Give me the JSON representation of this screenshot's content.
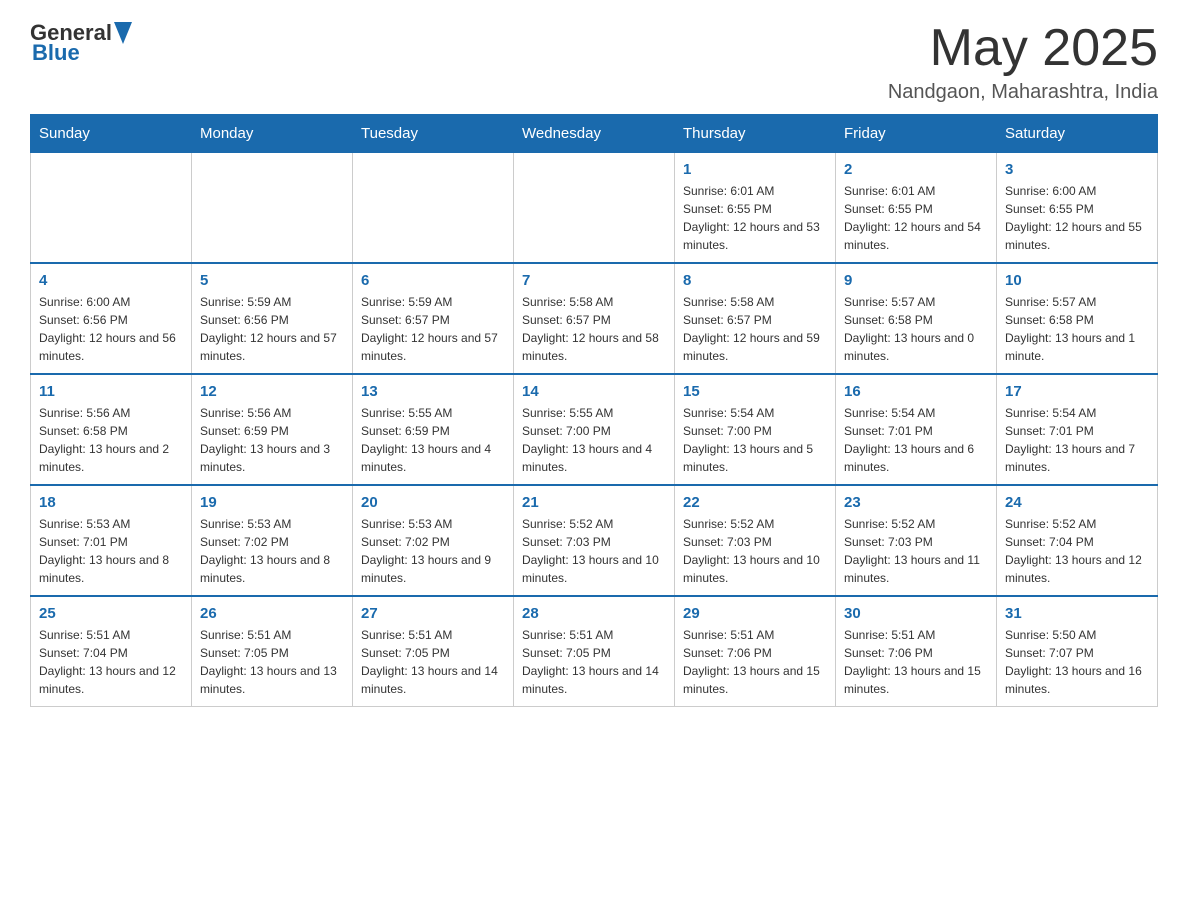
{
  "header": {
    "logo": {
      "general": "General",
      "blue": "Blue"
    },
    "title": "May 2025",
    "location": "Nandgaon, Maharashtra, India"
  },
  "weekdays": [
    "Sunday",
    "Monday",
    "Tuesday",
    "Wednesday",
    "Thursday",
    "Friday",
    "Saturday"
  ],
  "weeks": [
    [
      {
        "day": "",
        "info": ""
      },
      {
        "day": "",
        "info": ""
      },
      {
        "day": "",
        "info": ""
      },
      {
        "day": "",
        "info": ""
      },
      {
        "day": "1",
        "info": "Sunrise: 6:01 AM\nSunset: 6:55 PM\nDaylight: 12 hours and 53 minutes."
      },
      {
        "day": "2",
        "info": "Sunrise: 6:01 AM\nSunset: 6:55 PM\nDaylight: 12 hours and 54 minutes."
      },
      {
        "day": "3",
        "info": "Sunrise: 6:00 AM\nSunset: 6:55 PM\nDaylight: 12 hours and 55 minutes."
      }
    ],
    [
      {
        "day": "4",
        "info": "Sunrise: 6:00 AM\nSunset: 6:56 PM\nDaylight: 12 hours and 56 minutes."
      },
      {
        "day": "5",
        "info": "Sunrise: 5:59 AM\nSunset: 6:56 PM\nDaylight: 12 hours and 57 minutes."
      },
      {
        "day": "6",
        "info": "Sunrise: 5:59 AM\nSunset: 6:57 PM\nDaylight: 12 hours and 57 minutes."
      },
      {
        "day": "7",
        "info": "Sunrise: 5:58 AM\nSunset: 6:57 PM\nDaylight: 12 hours and 58 minutes."
      },
      {
        "day": "8",
        "info": "Sunrise: 5:58 AM\nSunset: 6:57 PM\nDaylight: 12 hours and 59 minutes."
      },
      {
        "day": "9",
        "info": "Sunrise: 5:57 AM\nSunset: 6:58 PM\nDaylight: 13 hours and 0 minutes."
      },
      {
        "day": "10",
        "info": "Sunrise: 5:57 AM\nSunset: 6:58 PM\nDaylight: 13 hours and 1 minute."
      }
    ],
    [
      {
        "day": "11",
        "info": "Sunrise: 5:56 AM\nSunset: 6:58 PM\nDaylight: 13 hours and 2 minutes."
      },
      {
        "day": "12",
        "info": "Sunrise: 5:56 AM\nSunset: 6:59 PM\nDaylight: 13 hours and 3 minutes."
      },
      {
        "day": "13",
        "info": "Sunrise: 5:55 AM\nSunset: 6:59 PM\nDaylight: 13 hours and 4 minutes."
      },
      {
        "day": "14",
        "info": "Sunrise: 5:55 AM\nSunset: 7:00 PM\nDaylight: 13 hours and 4 minutes."
      },
      {
        "day": "15",
        "info": "Sunrise: 5:54 AM\nSunset: 7:00 PM\nDaylight: 13 hours and 5 minutes."
      },
      {
        "day": "16",
        "info": "Sunrise: 5:54 AM\nSunset: 7:01 PM\nDaylight: 13 hours and 6 minutes."
      },
      {
        "day": "17",
        "info": "Sunrise: 5:54 AM\nSunset: 7:01 PM\nDaylight: 13 hours and 7 minutes."
      }
    ],
    [
      {
        "day": "18",
        "info": "Sunrise: 5:53 AM\nSunset: 7:01 PM\nDaylight: 13 hours and 8 minutes."
      },
      {
        "day": "19",
        "info": "Sunrise: 5:53 AM\nSunset: 7:02 PM\nDaylight: 13 hours and 8 minutes."
      },
      {
        "day": "20",
        "info": "Sunrise: 5:53 AM\nSunset: 7:02 PM\nDaylight: 13 hours and 9 minutes."
      },
      {
        "day": "21",
        "info": "Sunrise: 5:52 AM\nSunset: 7:03 PM\nDaylight: 13 hours and 10 minutes."
      },
      {
        "day": "22",
        "info": "Sunrise: 5:52 AM\nSunset: 7:03 PM\nDaylight: 13 hours and 10 minutes."
      },
      {
        "day": "23",
        "info": "Sunrise: 5:52 AM\nSunset: 7:03 PM\nDaylight: 13 hours and 11 minutes."
      },
      {
        "day": "24",
        "info": "Sunrise: 5:52 AM\nSunset: 7:04 PM\nDaylight: 13 hours and 12 minutes."
      }
    ],
    [
      {
        "day": "25",
        "info": "Sunrise: 5:51 AM\nSunset: 7:04 PM\nDaylight: 13 hours and 12 minutes."
      },
      {
        "day": "26",
        "info": "Sunrise: 5:51 AM\nSunset: 7:05 PM\nDaylight: 13 hours and 13 minutes."
      },
      {
        "day": "27",
        "info": "Sunrise: 5:51 AM\nSunset: 7:05 PM\nDaylight: 13 hours and 14 minutes."
      },
      {
        "day": "28",
        "info": "Sunrise: 5:51 AM\nSunset: 7:05 PM\nDaylight: 13 hours and 14 minutes."
      },
      {
        "day": "29",
        "info": "Sunrise: 5:51 AM\nSunset: 7:06 PM\nDaylight: 13 hours and 15 minutes."
      },
      {
        "day": "30",
        "info": "Sunrise: 5:51 AM\nSunset: 7:06 PM\nDaylight: 13 hours and 15 minutes."
      },
      {
        "day": "31",
        "info": "Sunrise: 5:50 AM\nSunset: 7:07 PM\nDaylight: 13 hours and 16 minutes."
      }
    ]
  ]
}
